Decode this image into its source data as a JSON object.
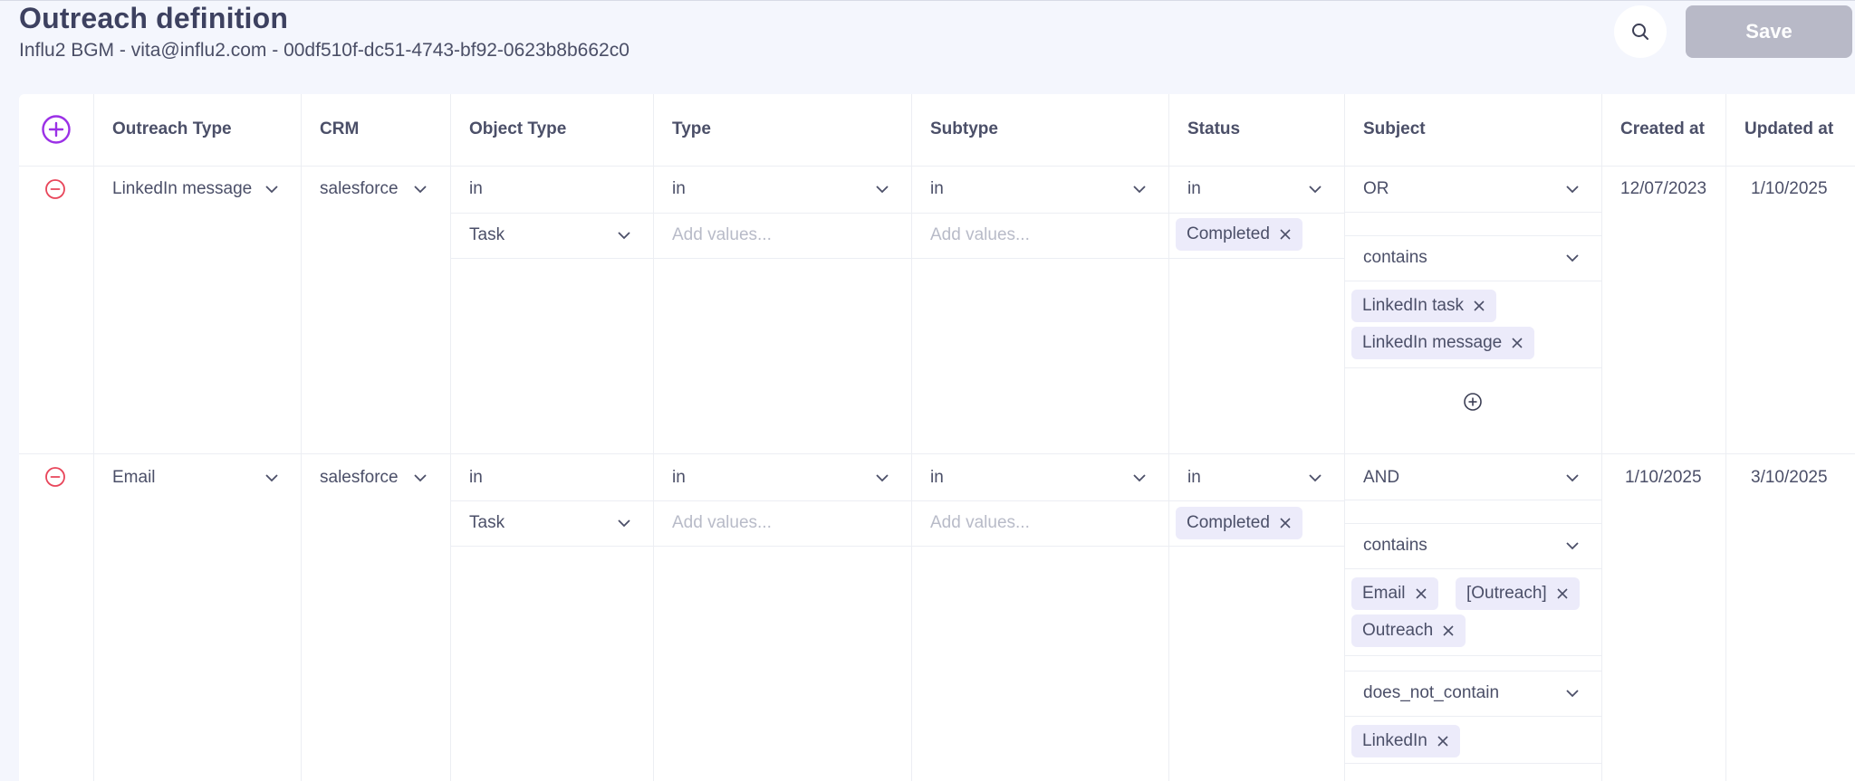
{
  "header": {
    "title": "Outreach definition",
    "subtitle": "Influ2 BGM - vita@influ2.com - 00df510f-dc51-4743-bf92-0623b8b662c0",
    "save_label": "Save"
  },
  "columns": [
    "Outreach Type",
    "CRM",
    "Object Type",
    "Type",
    "Subtype",
    "Status",
    "Subject",
    "Created at",
    "Updated at"
  ],
  "rows": [
    {
      "outreach_type": "LinkedIn message",
      "crm": "salesforce",
      "object_type_op": "in",
      "object_type_value": "Task",
      "type_op": "in",
      "type_placeholder": "Add values...",
      "subtype_op": "in",
      "subtype_placeholder": "Add values...",
      "status_op": "in",
      "status_chip": "Completed",
      "subject_logic": "OR",
      "subject_conditions": [
        {
          "op": "contains",
          "values": [
            "LinkedIn task",
            "LinkedIn message"
          ]
        }
      ],
      "created_at": "12/07/2023",
      "updated_at": "1/10/2025"
    },
    {
      "outreach_type": "Email",
      "crm": "salesforce",
      "object_type_op": "in",
      "object_type_value": "Task",
      "type_op": "in",
      "type_placeholder": "Add values...",
      "subtype_op": "in",
      "subtype_placeholder": "Add values...",
      "status_op": "in",
      "status_chip": "Completed",
      "subject_logic": "AND",
      "subject_conditions": [
        {
          "op": "contains",
          "values": [
            "Email",
            "[Outreach]",
            "Outreach"
          ]
        },
        {
          "op": "does_not_contain",
          "values": [
            "LinkedIn"
          ]
        }
      ],
      "created_at": "1/10/2025",
      "updated_at": "3/10/2025"
    }
  ],
  "colors": {
    "accent": "#9b30e6",
    "remove": "#e8455a",
    "chip_bg": "#ecebfa",
    "save_disabled": "#b8b9c7"
  },
  "icons": [
    "search-icon",
    "add-row-icon",
    "remove-row-icon",
    "chevron-down-icon",
    "chip-remove-icon",
    "add-condition-icon"
  ]
}
